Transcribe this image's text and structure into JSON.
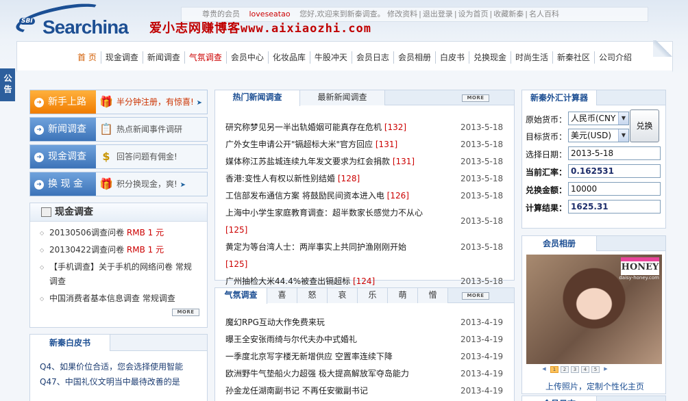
{
  "header": {
    "logo_badge": "SBI",
    "logo_text": "Searchina",
    "blog_cn": "爱小志网赚博客",
    "blog_url": "www.aixiaozhi.com",
    "userbar": {
      "greeting_prefix": "尊贵的会员",
      "username": "loveseatao",
      "greeting_suffix": "您好,欢迎来到新秦调查。",
      "links": [
        "修改资料",
        "退出登录",
        "设为首页",
        "收藏新秦",
        "名人百科"
      ]
    }
  },
  "nav": {
    "items": [
      "首 页",
      "现金调查",
      "新闻调查",
      "气氛调查",
      "会员中心",
      "化妆品库",
      "牛股冲天",
      "会员日志",
      "会员相册",
      "白皮书",
      "兑换现金",
      "时尚生活",
      "新秦社区",
      "公司介绍"
    ]
  },
  "notice": {
    "label": "公告"
  },
  "quick_links": [
    {
      "button": "新手上路",
      "icon": "gift-person-icon",
      "text": "半分钟注册，有惊喜!"
    },
    {
      "button": "新闻调查",
      "icon": "clipboard-icon",
      "text": "热点新闻事件调研"
    },
    {
      "button": "现金调查",
      "icon": "dollar-icon",
      "text": "回答问题有佣金!"
    },
    {
      "button": "换 现 金",
      "icon": "gift-box-icon",
      "text": "积分换现金，爽!"
    }
  ],
  "cash_survey": {
    "title": "现金调查",
    "items": [
      {
        "text": "20130506调查问卷 ",
        "reward": "RMB 1 元"
      },
      {
        "text": "20130422调查问卷 ",
        "reward": "RMB 1 元"
      },
      {
        "text": "【手机调查】关于手机的网络问卷 常规调查",
        "reward": ""
      },
      {
        "text": "中国消费者基本信息调查 常规调查",
        "reward": ""
      }
    ],
    "more": "MORE"
  },
  "whitepaper": {
    "title": "新秦白皮书",
    "items": [
      "Q4、如果价位合适，您会选择使用智能",
      "Q47、中国礼仪文明当中最待改善的是"
    ]
  },
  "hot_news": {
    "tabs": [
      "热门新闻调查",
      "最新新闻调查"
    ],
    "more": "MORE",
    "items": [
      {
        "title": "研究称梦见另一半出轨婚姻可能真存在危机",
        "count": "[132]",
        "date": "2013-5-18"
      },
      {
        "title": "广外女生申请公开\"镉超标大米\"官方回应",
        "count": "[131]",
        "date": "2013-5-18"
      },
      {
        "title": "媒体称江苏盐城连续九年发文要求为红会捐款",
        "count": "[131]",
        "date": "2013-5-18"
      },
      {
        "title": "香港:变性人有权以新性别结婚",
        "count": "[128]",
        "date": "2013-5-18"
      },
      {
        "title": "工信部发布通信方案 将鼓励民间资本进入电",
        "count": "[126]",
        "date": "2013-5-18"
      },
      {
        "title": "上海中小学生家庭教育调查：超半数家长感觉力不从心",
        "count": "[125]",
        "date": "2013-5-18"
      },
      {
        "title": "黄定为等台湾人士：两岸事实上共同护渔刚刚开始",
        "count": "[125]",
        "date": "2013-5-18"
      },
      {
        "title": "广州抽检大米44.4%被查出镉超标",
        "count": "[124]",
        "date": "2013-5-18"
      }
    ]
  },
  "mood_survey": {
    "tabs": [
      "气氛调查",
      "喜",
      "怒",
      "哀",
      "乐",
      "萌",
      "憎"
    ],
    "more": "MORE",
    "items": [
      {
        "title": "魔幻RPG互动大作免费来玩",
        "date": "2013-4-19"
      },
      {
        "title": "曝王全安张雨绮与尔代夫办中式婚礼",
        "date": "2013-4-19"
      },
      {
        "title": "一季度北京写字楼无新增供应 空置率连续下降",
        "date": "2013-4-19"
      },
      {
        "title": "欧洲野牛气垫船火力超强 极大提高解放军夺岛能力",
        "date": "2013-4-19"
      },
      {
        "title": "孙金龙任湖南副书记 不再任安徽副书记",
        "date": "2013-4-19"
      }
    ]
  },
  "fx_calc": {
    "title": "新秦外汇计算器",
    "source_label": "原始货币：",
    "source_value": "人民币(CNY",
    "target_label": "目标货币：",
    "target_value": "美元(USD)",
    "convert_label": "兑换",
    "date_label": "选择日期：",
    "date_value": "2013-5-18",
    "rate_label": "当前汇率：",
    "rate_value": "0.162531",
    "amount_label": "兑换金额：",
    "amount_value": "10000",
    "result_label": "计算结果：",
    "result_value": "1625.31"
  },
  "album": {
    "title": "会员相册",
    "badge": "HONEY",
    "badge_caption": "daisy-honey.com",
    "pages": [
      "1",
      "2",
      "3",
      "4",
      "5"
    ],
    "active_page": "1",
    "upload_text": "上传照片，定制个性化主页"
  },
  "member_log": {
    "title": "会员日志"
  }
}
